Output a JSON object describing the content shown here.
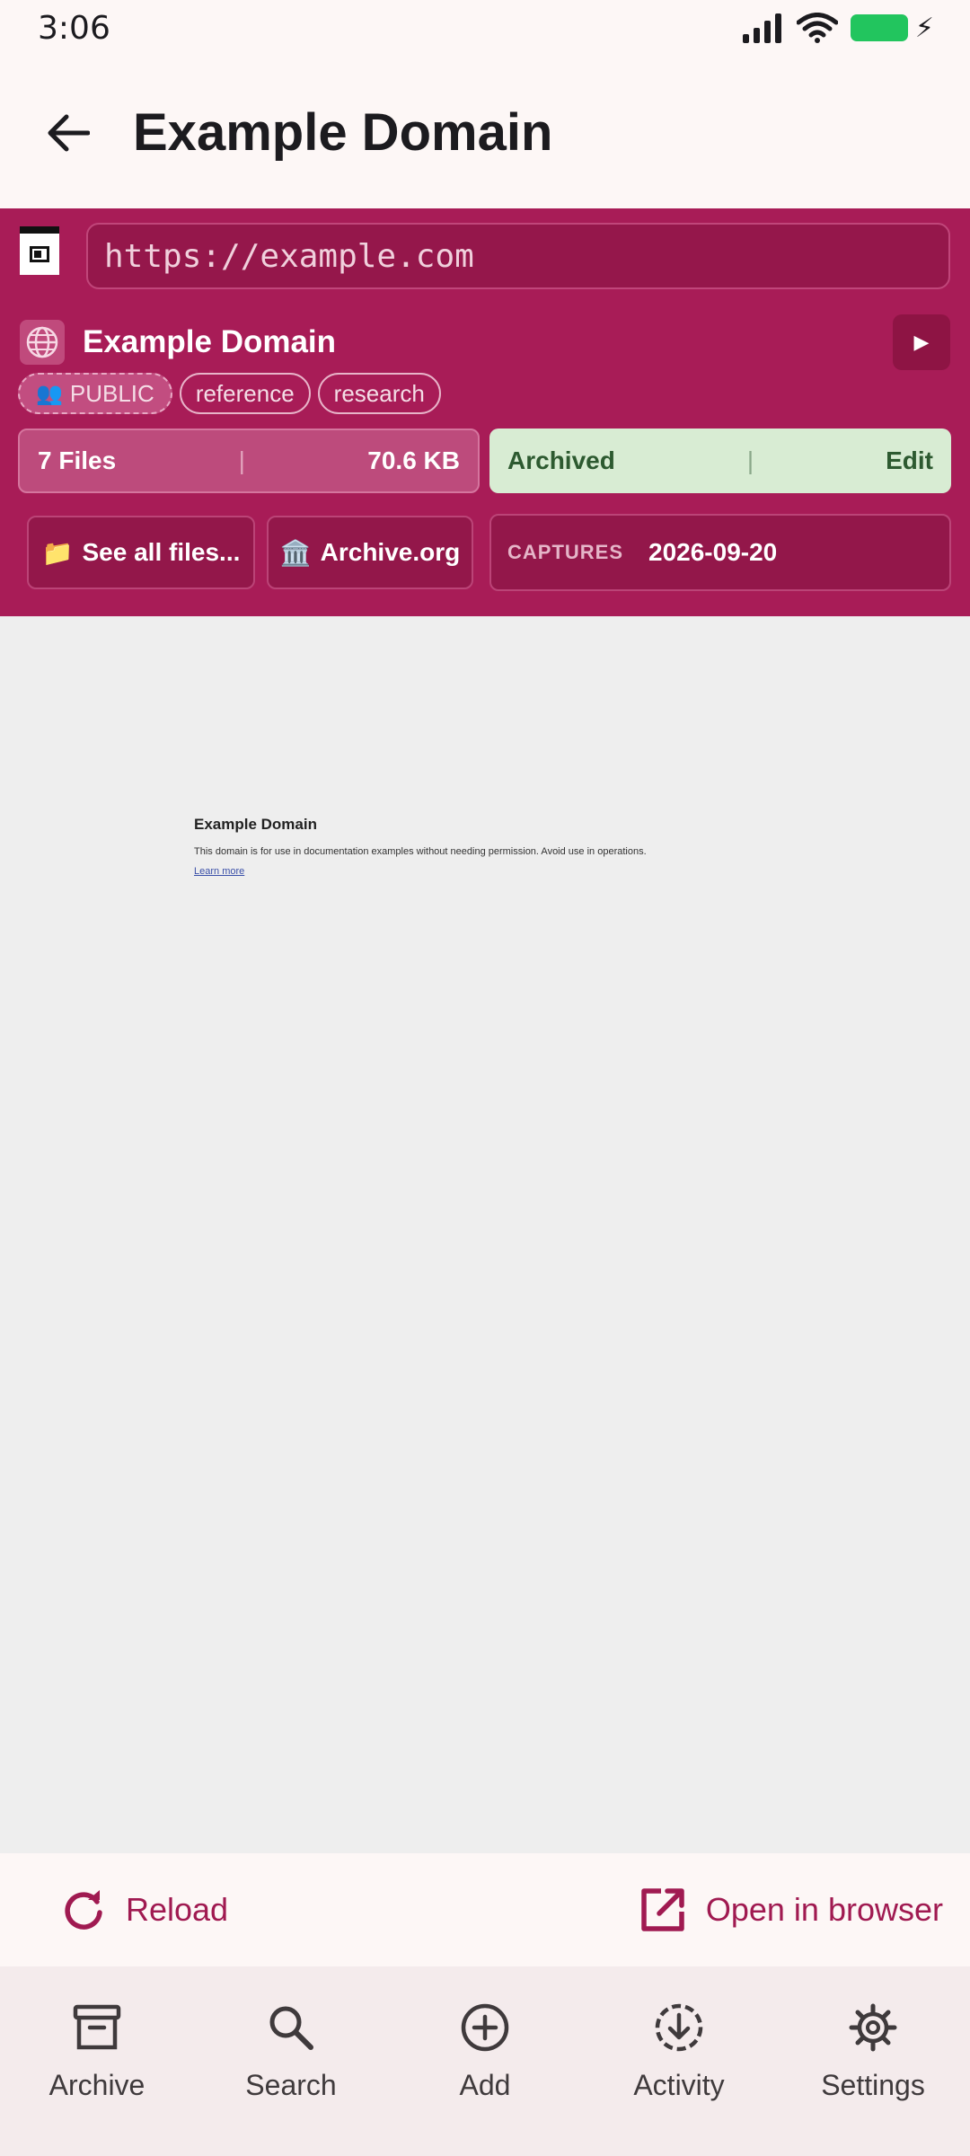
{
  "status_bar": {
    "time": "3:06"
  },
  "top_bar": {
    "title": "Example Domain"
  },
  "snapshot": {
    "url": "https://example.com",
    "title": "Example Domain",
    "tags": {
      "public": "PUBLIC",
      "tag1": "reference",
      "tag2": "research"
    },
    "files": {
      "count": "7 Files",
      "size": "70.6 KB"
    },
    "status": {
      "label": "Archived",
      "edit": "Edit"
    },
    "buttons": {
      "see_all": "See all files...",
      "archive_org": "Archive.org"
    },
    "captures": {
      "label": "CAPTURES",
      "date": "2026-09-20"
    },
    "separator": "|"
  },
  "webview": {
    "heading": "Example Domain",
    "body": "This domain is for use in documentation examples without needing permission. Avoid use in operations.",
    "link": "Learn more"
  },
  "actions": {
    "reload": "Reload",
    "open_browser": "Open in browser"
  },
  "nav": {
    "items": [
      {
        "label": "Archive",
        "icon": "archive-icon"
      },
      {
        "label": "Search",
        "icon": "search-icon"
      },
      {
        "label": "Add",
        "icon": "add-icon"
      },
      {
        "label": "Activity",
        "icon": "activity-icon"
      },
      {
        "label": "Settings",
        "icon": "settings-icon"
      }
    ]
  },
  "colors": {
    "brand": "#a81c57",
    "archived_bg": "#d8ecd3",
    "archived_text": "#2d5a30",
    "battery": "#22c55e"
  }
}
